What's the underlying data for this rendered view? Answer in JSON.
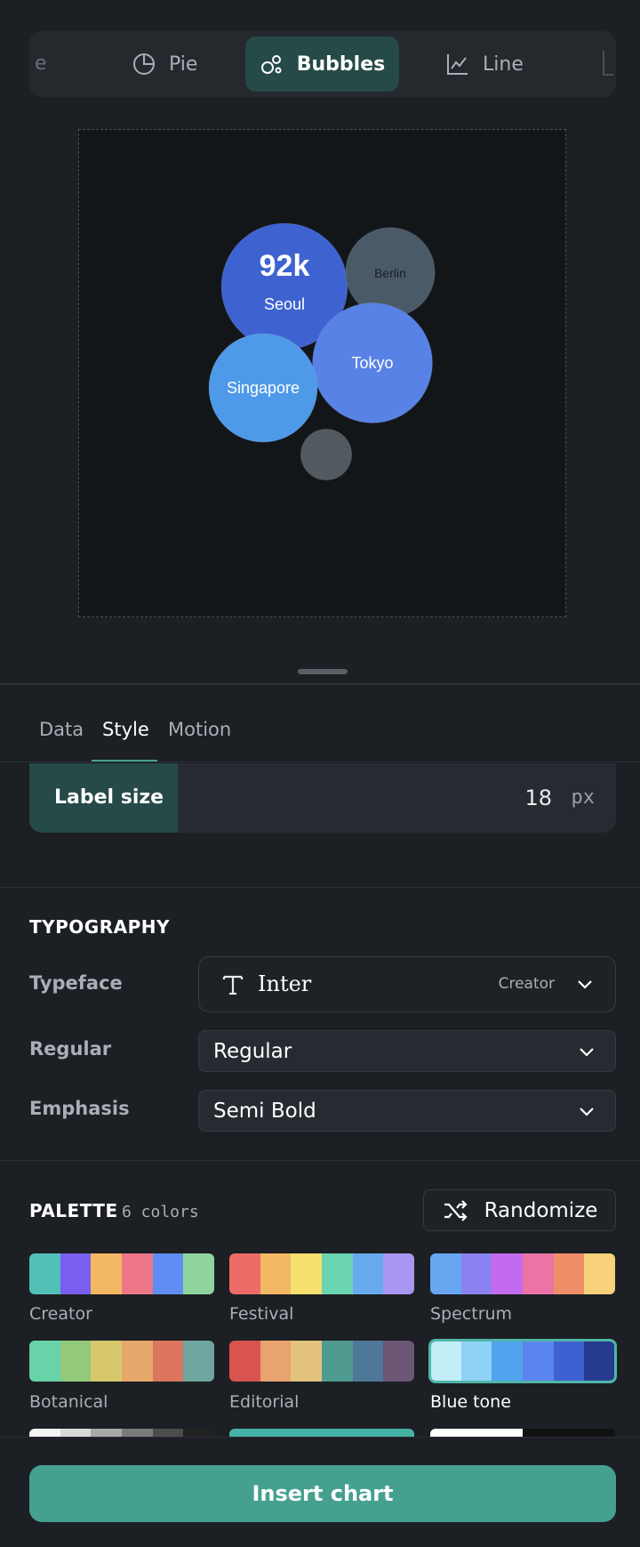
{
  "chart_types": {
    "partial_left_label": "e",
    "items": [
      {
        "label": "Pie",
        "icon": "pie-chart-icon"
      },
      {
        "label": "Bubbles",
        "icon": "bubbles-icon"
      },
      {
        "label": "Line",
        "icon": "line-chart-icon"
      }
    ],
    "active": "Bubbles"
  },
  "chart_data": {
    "type": "bubble",
    "highlight_value": "92k",
    "bubbles": [
      {
        "label": "Seoul",
        "value": 92,
        "color": "#3e63d1",
        "value_label": "92k"
      },
      {
        "label": "Berlin",
        "value": 46,
        "color": "#4b5a68"
      },
      {
        "label": "Tokyo",
        "value": 83,
        "color": "#5882e6"
      },
      {
        "label": "Singapore",
        "value": 68,
        "color": "#4f9ae8"
      },
      {
        "label": "",
        "value": 15,
        "color": "#525a61"
      }
    ]
  },
  "subtabs": {
    "items": [
      "Data",
      "Style",
      "Motion"
    ],
    "active": "Style"
  },
  "label_size": {
    "label": "Label size",
    "value": "18",
    "unit": "px"
  },
  "typography": {
    "title": "TYPOGRAPHY",
    "typeface_label": "Typeface",
    "typeface_value": "Inter",
    "typeface_source": "Creator",
    "regular_label": "Regular",
    "regular_value": "Regular",
    "emphasis_label": "Emphasis",
    "emphasis_value": "Semi Bold"
  },
  "palette": {
    "title": "PALETTE",
    "count": "6 colors",
    "randomize_label": "Randomize",
    "selected": "Blue tone",
    "items": [
      {
        "name": "Creator",
        "colors": [
          "#53c0b8",
          "#7a5ef0",
          "#f2b864",
          "#ee7689",
          "#5f8df2",
          "#8fd39e"
        ]
      },
      {
        "name": "Festival",
        "colors": [
          "#ee6b67",
          "#f2b864",
          "#f8e06e",
          "#6bd5b1",
          "#67aaee",
          "#a896f0"
        ]
      },
      {
        "name": "Spectrum",
        "colors": [
          "#67a7f2",
          "#8a82f0",
          "#c36bee",
          "#ec73a6",
          "#ef8f69",
          "#f7d27a"
        ]
      },
      {
        "name": "Botanical",
        "colors": [
          "#68d2a8",
          "#92ca7a",
          "#d7c86c",
          "#e6a86a",
          "#db755d",
          "#6fa6a0"
        ]
      },
      {
        "name": "Editorial",
        "colors": [
          "#d9534f",
          "#e8a36f",
          "#e3c37e",
          "#4f9b8f",
          "#4f7799",
          "#6b5676"
        ]
      },
      {
        "name": "Blue tone",
        "colors": [
          "#c3eef8",
          "#8dd1f6",
          "#52a3ee",
          "#5a85ee",
          "#3f60d0",
          "#263a8f"
        ]
      }
    ],
    "partial_row": [
      {
        "colors": [
          "#f4f4f4",
          "#d9d9d9",
          "#a8a8a8",
          "#7b7b7b",
          "#4d4d4d",
          "#222222"
        ]
      },
      {
        "colors": [
          "#45b2a6",
          "#45b2a6",
          "#45b2a6",
          "#45b2a6",
          "#45b2a6",
          "#45b2a6"
        ]
      },
      {
        "colors": [
          "#ffffff",
          "#ffffff",
          "#ffffff",
          "#111111",
          "#111111",
          "#111111"
        ]
      }
    ]
  },
  "footer": {
    "insert_label": "Insert chart"
  }
}
